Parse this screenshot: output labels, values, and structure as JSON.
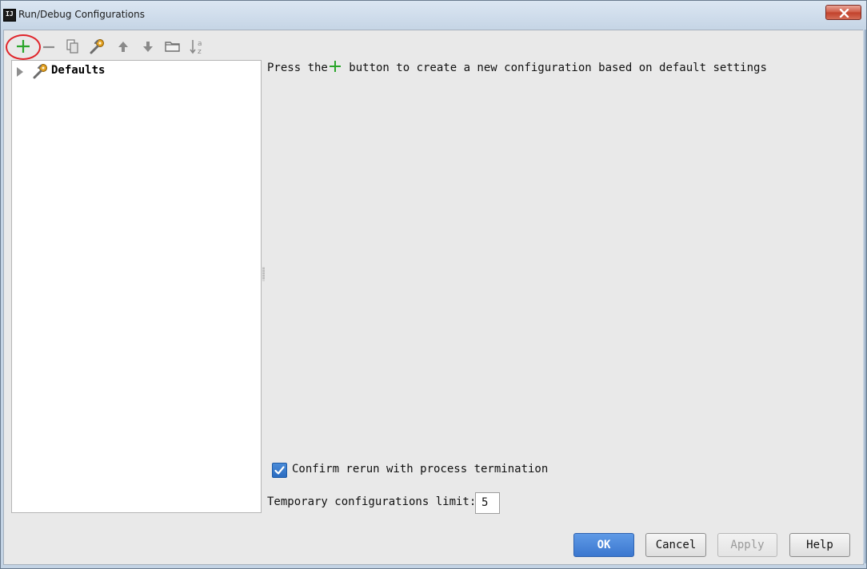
{
  "window": {
    "title": "Run/Debug Configurations",
    "app_icon_text": "IJ"
  },
  "toolbar": {
    "buttons": [
      "add-icon",
      "remove-icon",
      "copy-icon",
      "edit-defaults-icon",
      "move-up-icon",
      "move-down-icon",
      "folder-icon",
      "sort-icon"
    ],
    "add_color": "#2aa52a",
    "highlight_color": "#e0242a"
  },
  "tree": {
    "items": [
      {
        "label": "Defaults",
        "icon": "wrench-gear-icon"
      }
    ]
  },
  "info": {
    "prefix": "Press the",
    "suffix": " button to create a new configuration based on default settings"
  },
  "options": {
    "confirm_rerun_label": "Confirm rerun with process termination",
    "confirm_rerun_checked": true,
    "temp_limit_label": "Temporary configurations limit:",
    "temp_limit_value": "5"
  },
  "buttons": {
    "ok": "OK",
    "cancel": "Cancel",
    "apply": "Apply",
    "help": "Help"
  },
  "colors": {
    "ok_button": "#3b77cf",
    "checkbox": "#2a6cc0"
  }
}
